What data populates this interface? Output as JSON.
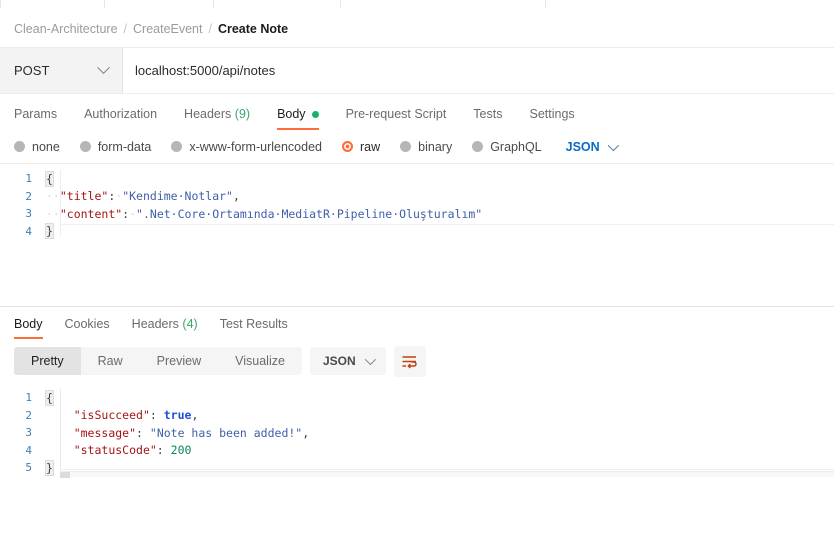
{
  "breadcrumb": {
    "root": "Clean-Architecture",
    "sep": "/",
    "folder": "CreateEvent",
    "current": "Create Note"
  },
  "request": {
    "method": "POST",
    "url": "localhost:5000/api/notes",
    "tabs": [
      {
        "label": "Params",
        "active": false
      },
      {
        "label": "Authorization",
        "active": false
      },
      {
        "label": "Headers",
        "count": "(9)",
        "active": false
      },
      {
        "label": "Body",
        "active": true,
        "indicator": "green-dot"
      },
      {
        "label": "Pre-request Script",
        "active": false
      },
      {
        "label": "Tests",
        "active": false
      },
      {
        "label": "Settings",
        "active": false
      }
    ],
    "body_types": [
      {
        "label": "none",
        "selected": false
      },
      {
        "label": "form-data",
        "selected": false
      },
      {
        "label": "x-www-form-urlencoded",
        "selected": false
      },
      {
        "label": "raw",
        "selected": true
      },
      {
        "label": "binary",
        "selected": false
      },
      {
        "label": "GraphQL",
        "selected": false
      }
    ],
    "format_label": "JSON",
    "body_lines": [
      {
        "no": "1",
        "open_brace": "{"
      },
      {
        "no": "2",
        "ws": "··",
        "key": "\"title\"",
        "colon": ":",
        "sep": "·",
        "value": "\"Kendime·Notlar\"",
        "tail": ","
      },
      {
        "no": "3",
        "ws": "··",
        "key": "\"content\"",
        "colon": ":",
        "sep": "·",
        "value": "\".Net·Core·Ortamında·MediatR·Pipeline·Oluşturalım\"",
        "tail": ""
      },
      {
        "no": "4",
        "close_brace": "}"
      }
    ]
  },
  "response": {
    "tabs": [
      {
        "label": "Body",
        "active": true
      },
      {
        "label": "Cookies",
        "active": false
      },
      {
        "label": "Headers",
        "count": "(4)",
        "active": false
      },
      {
        "label": "Test Results",
        "active": false
      }
    ],
    "view_modes": [
      {
        "label": "Pretty",
        "active": true
      },
      {
        "label": "Raw",
        "active": false
      },
      {
        "label": "Preview",
        "active": false
      },
      {
        "label": "Visualize",
        "active": false
      }
    ],
    "format_label": "JSON",
    "wrap_icon": "word-wrap-icon",
    "body_lines": [
      {
        "no": "1",
        "open_brace": "{"
      },
      {
        "no": "2",
        "indent": "    ",
        "key": "\"isSucceed\"",
        "colon": ":",
        "sep": " ",
        "bool": "true",
        "tail": ","
      },
      {
        "no": "3",
        "indent": "    ",
        "key": "\"message\"",
        "colon": ":",
        "sep": " ",
        "value": "\"Note has been added!\"",
        "tail": ","
      },
      {
        "no": "4",
        "indent": "    ",
        "key": "\"statusCode\"",
        "colon": ":",
        "sep": " ",
        "number": "200",
        "tail": ""
      },
      {
        "no": "5",
        "close_brace": "}"
      }
    ]
  },
  "colors": {
    "accent": "#ff6c37",
    "json_key": "#a31515",
    "json_string": "#4060a8",
    "json_number": "#0a8656",
    "json_bool": "#1f4fd8",
    "link_blue": "#0b6bcb",
    "count_green": "#3aa76d",
    "dot_green": "#16b364"
  }
}
